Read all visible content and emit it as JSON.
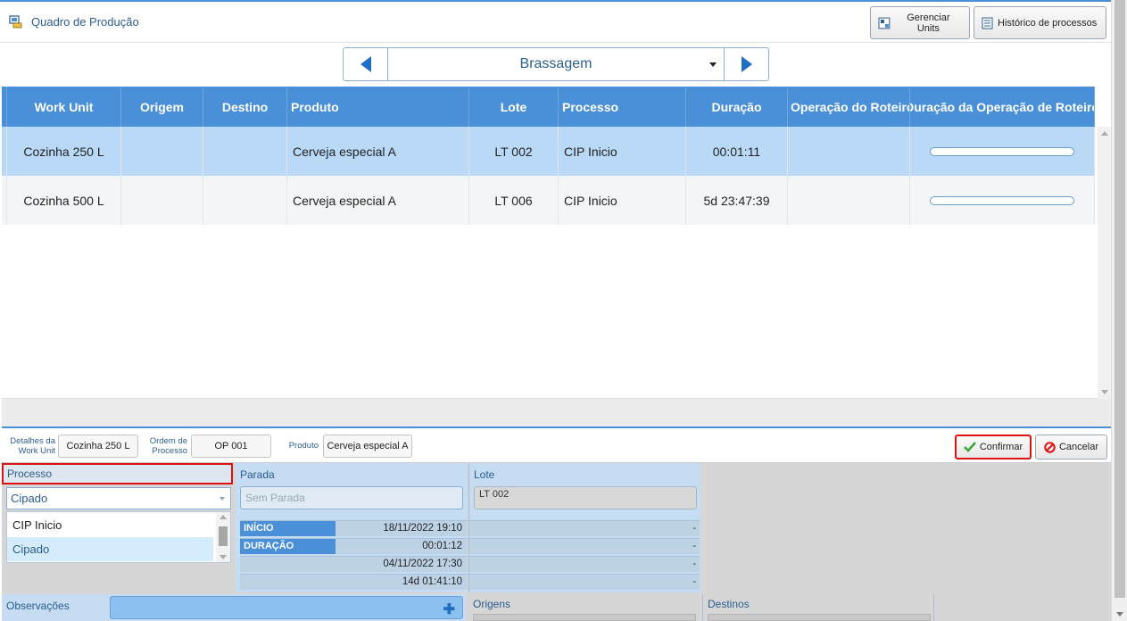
{
  "header": {
    "title": "Quadro de Produção",
    "btn_gerenciar": "Gerenciar Units",
    "btn_historico": "Histórico de processos"
  },
  "stage": {
    "name": "Brassagem"
  },
  "table": {
    "columns": [
      "Work Unit",
      "Origem",
      "Destino",
      "Produto",
      "Lote",
      "Processo",
      "Duração",
      "Operação do Roteiro",
      "Duração da Operação de Roteiro"
    ],
    "rows": [
      {
        "work_unit": "Cozinha 250 L",
        "origem": "",
        "destino": "",
        "produto": "Cerveja especial A",
        "lote": "LT 002",
        "processo": "CIP Inicio",
        "duracao": "00:01:11",
        "operacao": "",
        "progress": 0
      },
      {
        "work_unit": "Cozinha 500 L",
        "origem": "",
        "destino": "",
        "produto": "Cerveja especial A",
        "lote": "LT 006",
        "processo": "CIP Inicio",
        "duracao": "5d 23:47:39",
        "operacao": "",
        "progress": 0
      }
    ]
  },
  "details": {
    "work_unit_label": "Detalhes da Work Unit",
    "work_unit_value": "Cozinha 250 L",
    "ordem_label": "Ordem de Processo",
    "ordem_value": "OP 001",
    "produto_label": "Produto",
    "produto_value": "Cerveja especial A",
    "confirmar": "Confirmar",
    "cancelar": "Cancelar"
  },
  "form": {
    "processo_label": "Processo",
    "processo_selected": "Cipado",
    "processo_options": [
      "CIP Inicio",
      "Cipado"
    ],
    "parada_label": "Parada",
    "parada_placeholder": "Sem Parada",
    "inicio_label": "INÍCIO",
    "inicio_value": "18/11/2022 19:10",
    "duracao_label": "DURAÇÃO",
    "duracao_value": "00:01:12",
    "row3_value": "04/11/2022 17:30",
    "row4_value": "14d 01:41:10",
    "lote_label": "Lote",
    "lote_value": "LT 002",
    "lote_row_values": [
      "-",
      "-",
      "-",
      "-"
    ],
    "observacoes_label": "Observações",
    "origens_label": "Origens",
    "destinos_label": "Destinos"
  },
  "colors": {
    "accent": "#4a90d9",
    "selected_row": "#b9d9f7",
    "highlight_border": "#dd1111"
  }
}
